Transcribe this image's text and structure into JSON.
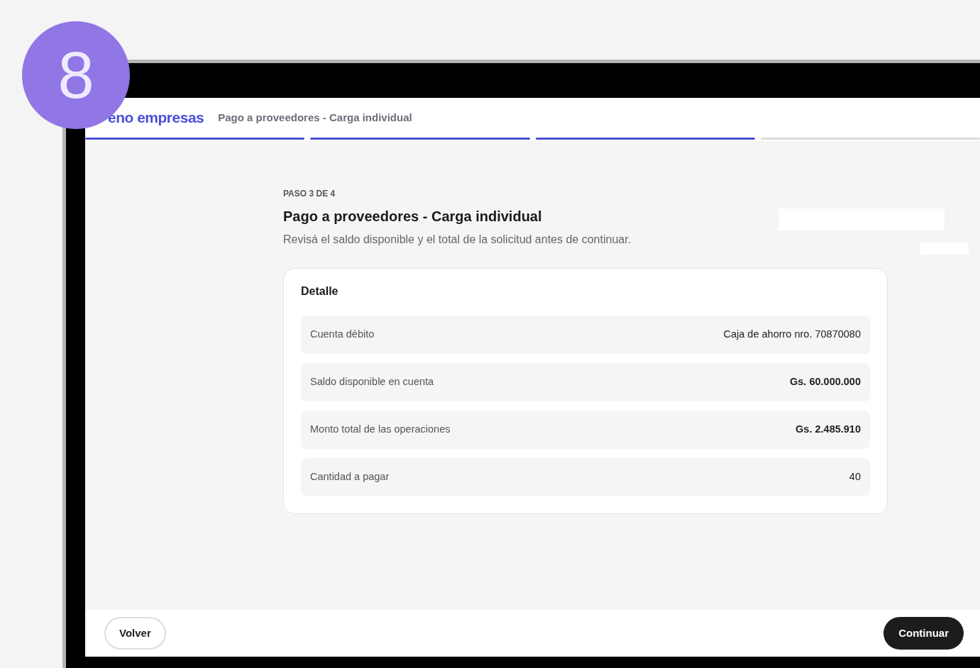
{
  "step_badge": "8",
  "header": {
    "logo": "eno empresas",
    "title": "Pago a proveedores - Carga individual"
  },
  "progress": [
    {
      "completed": true
    },
    {
      "completed": true
    },
    {
      "completed": true
    },
    {
      "completed": false
    }
  ],
  "step_label": "PASO 3 DE 4",
  "heading": "Pago a proveedores - Carga individual",
  "subtitle": "Revisá el saldo disponible y el total de la solicitud antes de continuar.",
  "detail": {
    "title": "Detalle",
    "rows": [
      {
        "label": "Cuenta débito",
        "value": "Caja de ahorro nro. 70870080",
        "emphasis": false
      },
      {
        "label": "Saldo disponible en cuenta",
        "value": "Gs. 60.000.000",
        "emphasis": true
      },
      {
        "label": "Monto total de las operaciones",
        "value": "Gs. 2.485.910",
        "emphasis": true
      },
      {
        "label": "Cantidad a pagar",
        "value": "40",
        "emphasis": false
      }
    ]
  },
  "footer": {
    "back": "Volver",
    "next": "Continuar"
  }
}
